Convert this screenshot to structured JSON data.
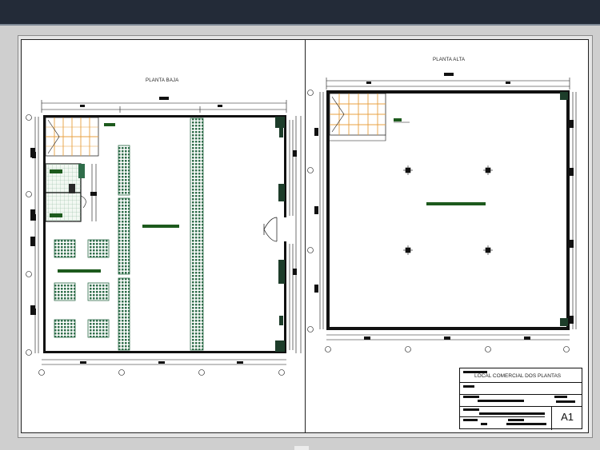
{
  "drawing": {
    "ground_floor_title": "PLANTA BAJA",
    "upper_floor_title": "PLANTA ALTA",
    "project_title": "LOCAL COMERCIAL DOS PLANTAS",
    "sheet_size": "A1"
  },
  "colors": {
    "wall": "#111111",
    "accent_green": "#1d5a1d",
    "stair": "#e8a040",
    "fixture_green": "#2f6d4a",
    "background": "#ffffff",
    "app_bar": "#232b38"
  }
}
